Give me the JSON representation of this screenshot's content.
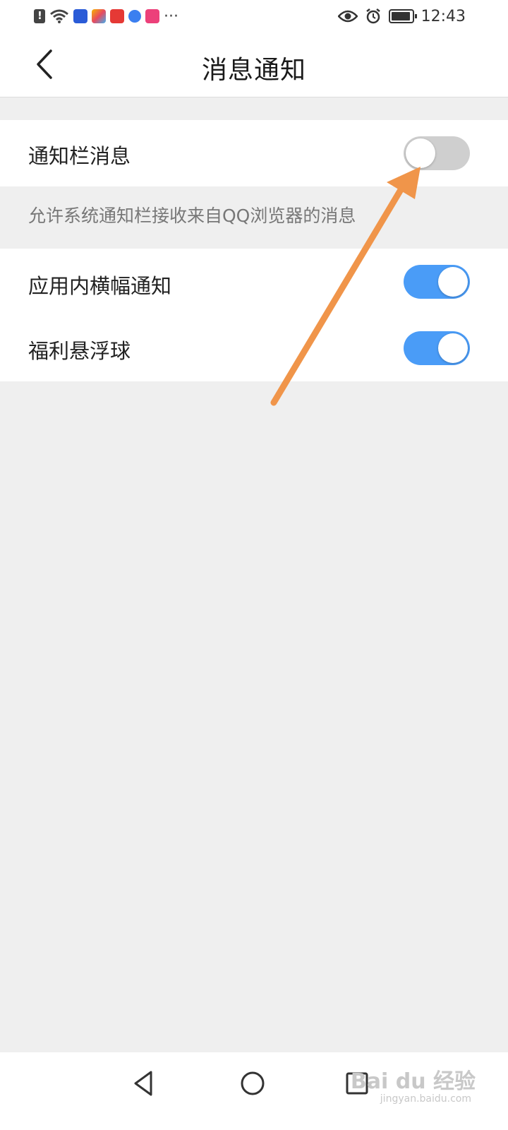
{
  "status_bar": {
    "more_indicator": "···",
    "time": "12:43",
    "left_icons": [
      "alert-icon",
      "wifi-icon",
      "baidu-app-icon",
      "app-icon",
      "music-app-icon",
      "music-note-icon",
      "video-app-icon"
    ],
    "right_icons": [
      "eye-icon",
      "alarm-icon",
      "battery-icon"
    ]
  },
  "header": {
    "title": "消息通知",
    "back_icon": "chevron-left-icon"
  },
  "settings": {
    "notification_bar": {
      "label": "通知栏消息",
      "enabled": false,
      "description": "允许系统通知栏接收来自QQ浏览器的消息"
    },
    "in_app_banner": {
      "label": "应用内横幅通知",
      "enabled": true
    },
    "welfare_float": {
      "label": "福利悬浮球",
      "enabled": true
    }
  },
  "nav_bar": {
    "icons": [
      "back-triangle-icon",
      "home-circle-icon",
      "recent-square-icon"
    ]
  },
  "watermark": {
    "text": "Bai du 经验",
    "sub": "jingyan.baidu.com"
  },
  "colors": {
    "toggle_on": "#4a9cf7",
    "toggle_off": "#cfcfcf",
    "arrow": "#f0954a",
    "background": "#efefef"
  }
}
